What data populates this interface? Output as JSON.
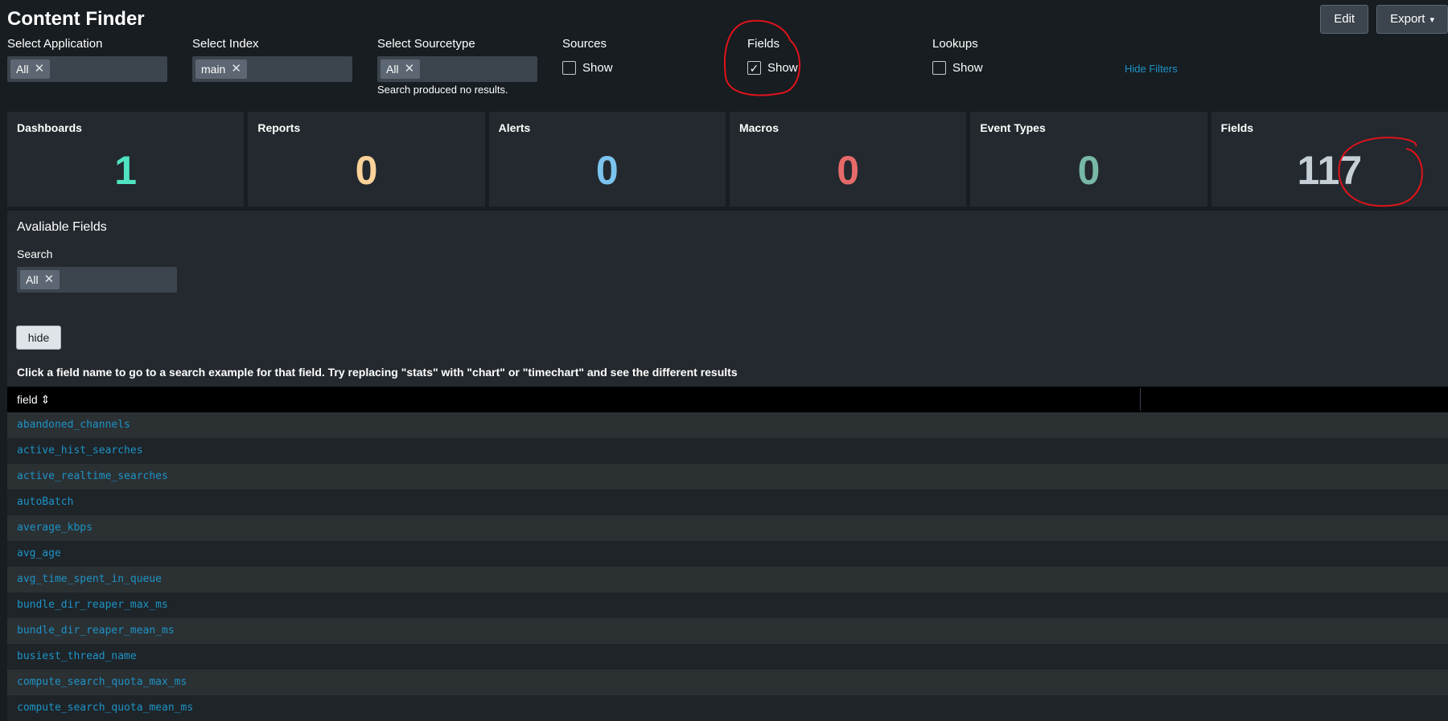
{
  "page": {
    "title": "Content Finder"
  },
  "toolbar": {
    "edit_label": "Edit",
    "export_label": "Export"
  },
  "filters": {
    "application": {
      "label": "Select Application",
      "chip": "All"
    },
    "index": {
      "label": "Select Index",
      "chip": "main"
    },
    "sourcetype": {
      "label": "Select Sourcetype",
      "chip": "All",
      "message": "Search produced no results."
    },
    "sources": {
      "label": "Sources",
      "checkbox_label": "Show",
      "checked": false
    },
    "fields": {
      "label": "Fields",
      "checkbox_label": "Show",
      "checked": true
    },
    "lookups": {
      "label": "Lookups",
      "checkbox_label": "Show",
      "checked": false
    },
    "hide_filters_label": "Hide Filters"
  },
  "panels": [
    {
      "title": "Dashboards",
      "value": "1",
      "color": "#4fe3c1"
    },
    {
      "title": "Reports",
      "value": "0",
      "color": "#fdd39a"
    },
    {
      "title": "Alerts",
      "value": "0",
      "color": "#7cc4ef"
    },
    {
      "title": "Macros",
      "value": "0",
      "color": "#e66a6a"
    },
    {
      "title": "Event Types",
      "value": "0",
      "color": "#78b8a6"
    },
    {
      "title": "Fields",
      "value": "117",
      "color": "#c7cfd6"
    }
  ],
  "fields_section": {
    "title": "Avaliable Fields",
    "search_label": "Search",
    "search_chip": "All",
    "hide_button_label": "hide",
    "instructions": "Click a field name to go to a search example for that field. Try replacing \"stats\" with \"chart\" or \"timechart\" and see the different results",
    "table": {
      "column_header": "field",
      "rows": [
        "abandoned_channels",
        "active_hist_searches",
        "active_realtime_searches",
        "autoBatch",
        "average_kbps",
        "avg_age",
        "avg_time_spent_in_queue",
        "bundle_dir_reaper_max_ms",
        "bundle_dir_reaper_mean_ms",
        "busiest_thread_name",
        "compute_search_quota_max_ms",
        "compute_search_quota_mean_ms"
      ]
    }
  },
  "colors": {
    "link": "#1e93c6",
    "background": "#171d21",
    "panel": "#23292e",
    "annotation": "#e0131b"
  }
}
